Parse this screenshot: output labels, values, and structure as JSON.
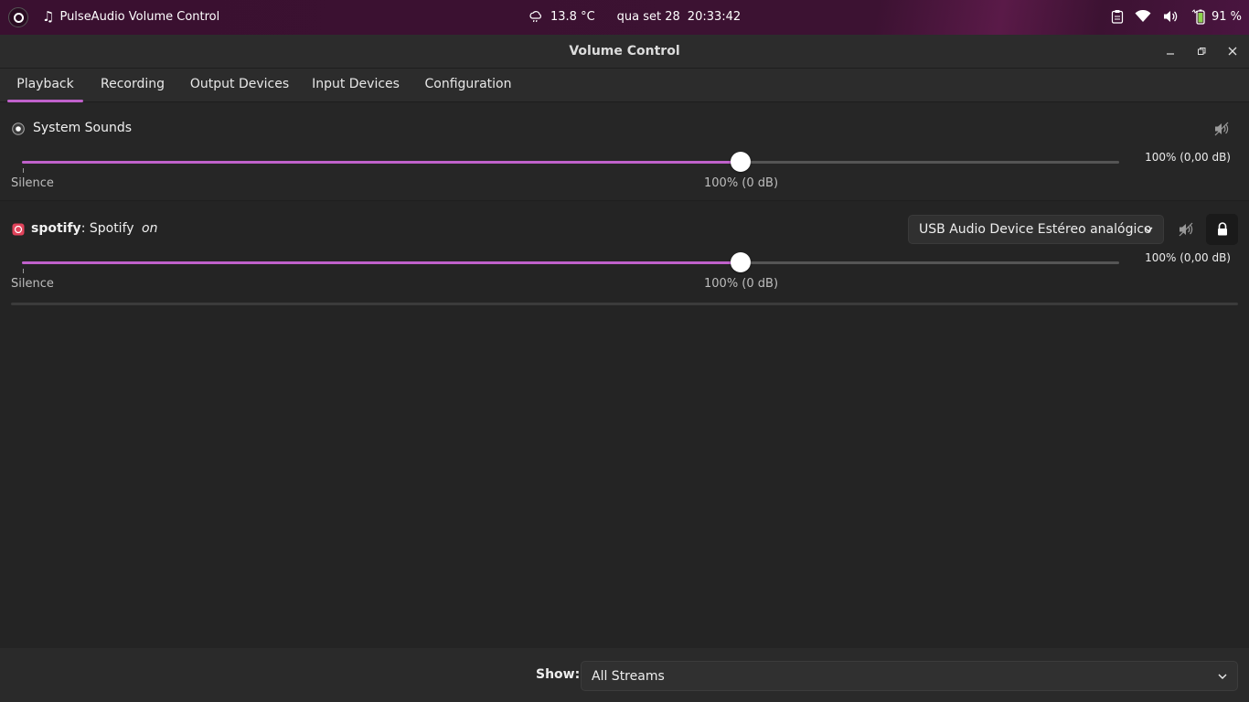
{
  "topbar": {
    "app_name": "PulseAudio Volume Control",
    "weather": "13.8 °C",
    "date": "qua set 28",
    "time": "20:33:42",
    "battery": "91 %"
  },
  "window": {
    "title": "Volume Control"
  },
  "tabs": [
    {
      "label": "Playback",
      "active": true
    },
    {
      "label": "Recording",
      "active": false
    },
    {
      "label": "Output Devices",
      "active": false
    },
    {
      "label": "Input Devices",
      "active": false
    },
    {
      "label": "Configuration",
      "active": false
    }
  ],
  "streams": [
    {
      "name": "System Sounds",
      "volume_percent": 100,
      "db_label": "100% (0,00 dB)",
      "silence_label": "Silence",
      "mid_label": "100% (0 dB)"
    },
    {
      "app_bold": "spotify",
      "app_name": ": Spotify",
      "state": "on",
      "device": "USB Audio Device Estéreo analógico",
      "volume_percent": 100,
      "db_label": "100% (0,00 dB)",
      "silence_label": "Silence",
      "mid_label": "100% (0 dB)"
    }
  ],
  "bottom": {
    "show_label": "Show:",
    "show_value": "All Streams"
  },
  "colors": {
    "accent": "#c061cb",
    "background": "#242424",
    "topbar": "#3c1232"
  }
}
